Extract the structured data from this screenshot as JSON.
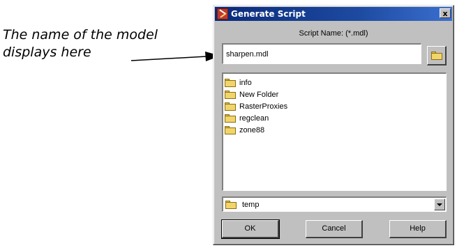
{
  "annotation": {
    "line1": "The name of the model",
    "line2": "displays here"
  },
  "dialog": {
    "title": "Generate Script",
    "close_label": "x",
    "script_name_label": "Script Name: (*.mdl)",
    "script_name_value": "sharpen.mdl",
    "folders": [
      {
        "name": "info",
        "icon": "folder-icon"
      },
      {
        "name": "New Folder",
        "icon": "folder-icon"
      },
      {
        "name": "RasterProxies",
        "icon": "folder-icon"
      },
      {
        "name": "regclean",
        "icon": "folder-icon"
      },
      {
        "name": "zone88",
        "icon": "folder-icon"
      }
    ],
    "current_dir": "temp",
    "buttons": {
      "ok": "OK",
      "cancel": "Cancel",
      "help": "Help"
    }
  },
  "colors": {
    "title_bar_start": "#0a2a7a",
    "title_bar_end": "#3a6fd0",
    "dialog_face": "#c0c0c0",
    "folder": "#f2d56a"
  }
}
